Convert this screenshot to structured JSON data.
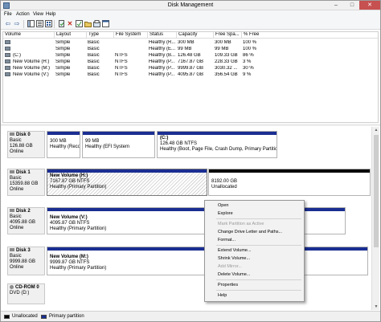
{
  "window": {
    "title": "Disk Management",
    "controls": {
      "minimize": "–",
      "maximize": "□",
      "close": "✕"
    }
  },
  "menu": [
    "File",
    "Action",
    "View",
    "Help"
  ],
  "toolbar": {
    "icons": [
      "back-arrow-icon",
      "forward-arrow-icon",
      "console-tree-icon",
      "help-icon",
      "properties-icon",
      "refresh-icon",
      "delete-icon",
      "check-icon",
      "open-icon",
      "explore-icon",
      "properties-sheet-icon"
    ],
    "glyphs": {
      "back": "⇦",
      "forward": "⇨",
      "delete": "✕"
    }
  },
  "volumes": {
    "columns": [
      "Volume",
      "Layout",
      "Type",
      "File System",
      "Status",
      "Capacity",
      "Free Spa...",
      "% Free"
    ],
    "rows": [
      [
        "",
        "Simple",
        "Basic",
        "",
        "Healthy (R...",
        "300 MB",
        "300 MB",
        "100 %"
      ],
      [
        "",
        "Simple",
        "Basic",
        "",
        "Healthy (E...",
        "99 MB",
        "99 MB",
        "100 %"
      ],
      [
        "(C:)",
        "Simple",
        "Basic",
        "NTFS",
        "Healthy (B...",
        "126.48 GB",
        "109.33 GB",
        "86 %"
      ],
      [
        "New Volume (H:)",
        "Simple",
        "Basic",
        "NTFS",
        "Healthy (P...",
        "7167.87 GB",
        "228.33 GB",
        "3 %"
      ],
      [
        "New Volume (M:)",
        "Simple",
        "Basic",
        "NTFS",
        "Healthy (P...",
        "9999.87 GB",
        "3030.32 ...",
        "30 %"
      ],
      [
        "New Volume (V:)",
        "Simple",
        "Basic",
        "NTFS",
        "Healthy (P...",
        "4095.87 GB",
        "356.54 GB",
        "9 %"
      ]
    ]
  },
  "disks": [
    {
      "name": "Disk 0",
      "type": "Basic",
      "size": "126.88 GB",
      "status": "Online",
      "partitions": [
        {
          "name": "",
          "size": "300 MB",
          "status": "Healthy (Recovery Partition)"
        },
        {
          "name": "",
          "size": "99 MB",
          "status": "Healthy (EFI System"
        },
        {
          "name": "(C:)",
          "size": "126.48 GB NTFS",
          "status": "Healthy (Boot, Page File, Crash Dump, Primary Partition)"
        }
      ]
    },
    {
      "name": "Disk 1",
      "type": "Basic",
      "size": "15359.88 GB",
      "status": "Online",
      "partitions": [
        {
          "name": "New Volume (H:)",
          "size": "7167.87 GB NTFS",
          "status": "Healthy (Primary Partition)"
        },
        {
          "name": "",
          "size": "8192.00 GB",
          "status": "Unallocated"
        }
      ]
    },
    {
      "name": "Disk 2",
      "type": "Basic",
      "size": "4095.88 GB",
      "status": "Online",
      "partitions": [
        {
          "name": "New Volume (V:)",
          "size": "4095.87 GB NTFS",
          "status": "Healthy (Primary Partition)"
        }
      ]
    },
    {
      "name": "Disk 3",
      "type": "Basic",
      "size": "9999.88 GB",
      "status": "Online",
      "partitions": [
        {
          "name": "New Volume (M:)",
          "size": "9999.87 GB NTFS",
          "status": "Healthy (Primary Partition)"
        }
      ]
    },
    {
      "name": "CD-ROM 0",
      "type": "DVD (D:)",
      "size": "",
      "status": "",
      "partitions": []
    }
  ],
  "context_menu": {
    "items": [
      {
        "label": "Open",
        "enabled": true
      },
      {
        "label": "Explore",
        "enabled": true
      },
      {
        "label": "Mark Partition as Active",
        "enabled": false
      },
      {
        "label": "Change Drive Letter and Paths...",
        "enabled": true
      },
      {
        "label": "Format...",
        "enabled": true
      },
      {
        "label": "Extend Volume...",
        "enabled": true
      },
      {
        "label": "Shrink Volume...",
        "enabled": true
      },
      {
        "label": "Add Mirror...",
        "enabled": false
      },
      {
        "label": "Delete Volume...",
        "enabled": true
      },
      {
        "label": "Properties",
        "enabled": true
      },
      {
        "label": "Help",
        "enabled": true
      }
    ]
  },
  "legend": {
    "unallocated": "Unallocated",
    "primary": "Primary partition",
    "colors": {
      "unallocated": "#000000",
      "primary": "#1a2e92"
    }
  },
  "scroll": {
    "up": "▲",
    "down": "▼"
  }
}
